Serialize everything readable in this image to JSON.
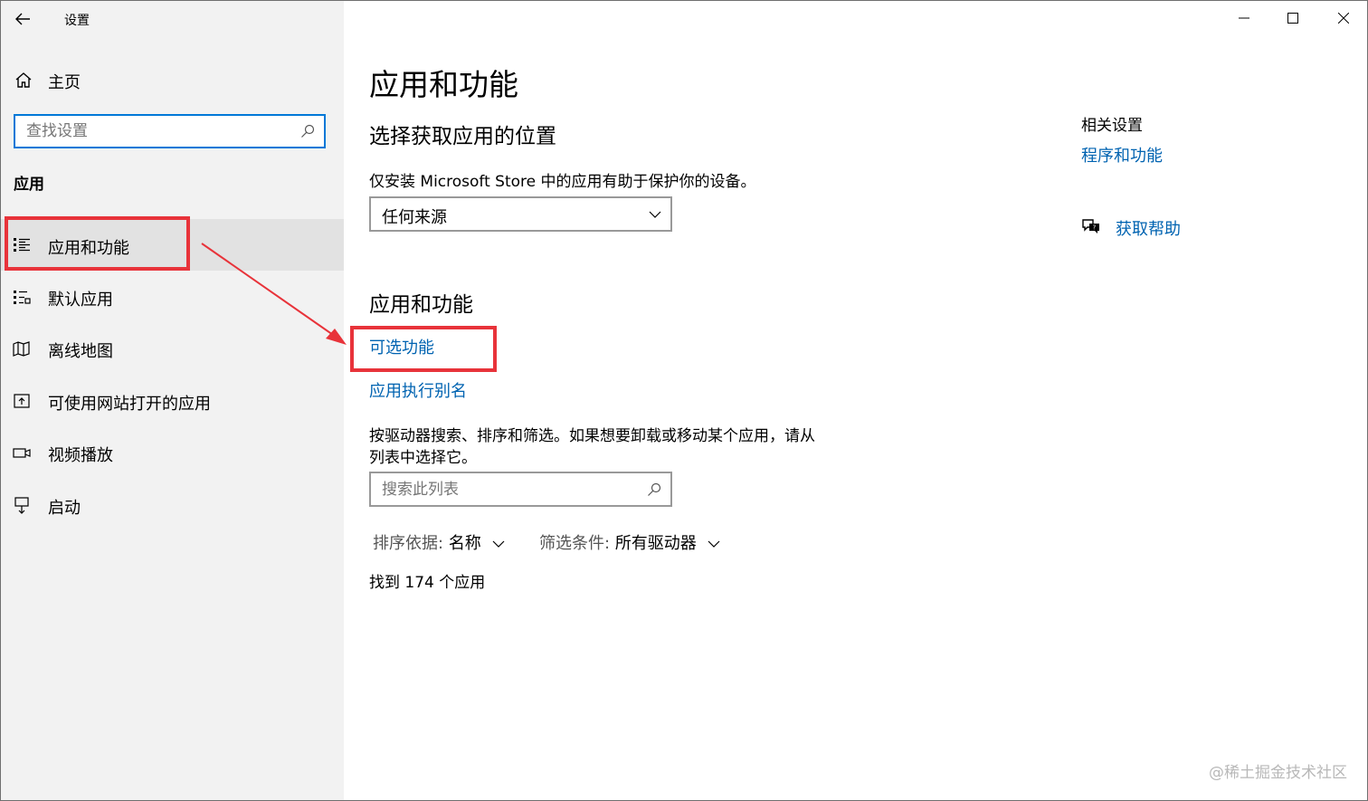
{
  "window": {
    "app_title": "设置",
    "back_icon": "arrow-left-icon",
    "controls": {
      "minimize": "—",
      "maximize": "☐",
      "close": "✕"
    }
  },
  "sidebar": {
    "home_label": "主页",
    "search_placeholder": "查找设置",
    "section_title": "应用",
    "items": [
      {
        "label": "应用和功能",
        "icon": "apps-list-icon",
        "selected": true
      },
      {
        "label": "默认应用",
        "icon": "default-apps-icon"
      },
      {
        "label": "离线地图",
        "icon": "map-icon"
      },
      {
        "label": "可使用网站打开的应用",
        "icon": "web-open-icon"
      },
      {
        "label": "视频播放",
        "icon": "video-icon"
      },
      {
        "label": "启动",
        "icon": "startup-icon"
      }
    ]
  },
  "main": {
    "page_title": "应用和功能",
    "install_section": {
      "heading": "选择获取应用的位置",
      "description": "仅安装 Microsoft Store 中的应用有助于保护你的设备。",
      "dropdown_value": "任何来源"
    },
    "apps_section": {
      "heading": "应用和功能",
      "optional_features_link": "可选功能",
      "app_alias_link": "应用执行别名",
      "description_line1": "按驱动器搜索、排序和筛选。如果想要卸载或移动某个应用，请从",
      "description_line2": "列表中选择它。",
      "search_placeholder": "搜索此列表",
      "sort_label": "排序依据:",
      "sort_value": "名称",
      "filter_label": "筛选条件:",
      "filter_value": "所有驱动器",
      "result_text": "找到 174 个应用"
    },
    "related": {
      "title": "相关设置",
      "programs_link": "程序和功能",
      "help_link": "获取帮助"
    }
  },
  "watermark": "@稀土掘金技术社区",
  "colors": {
    "accent": "#0078d7",
    "link": "#0063b1",
    "highlight": "#e8333a",
    "sidebar_bg": "#f2f2f2"
  }
}
